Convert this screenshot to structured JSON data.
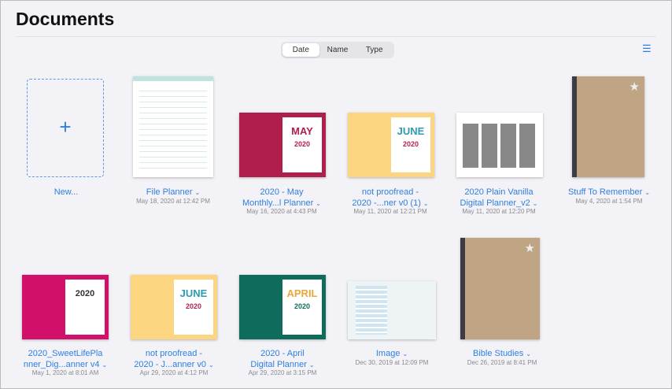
{
  "title": "Documents",
  "sort": {
    "options": [
      "Date",
      "Name",
      "Type"
    ],
    "selected": "Date"
  },
  "list_view_icon": "list-icon",
  "new_label": "New...",
  "row1": [
    {
      "l1": "File Planner",
      "l2": "",
      "date": "May 18, 2020 at 12:42 PM"
    },
    {
      "l1": "2020 - May",
      "l2": "Monthly...l Planner",
      "date": "May 16, 2020 at 4:43 PM"
    },
    {
      "l1": "not proofread -",
      "l2": "2020 -...ner v0 (1)",
      "date": "May 11, 2020 at 12:21 PM"
    },
    {
      "l1": "2020 Plain Vanilla",
      "l2": "Digital Planner_v2",
      "date": "May 11, 2020 at 12:20 PM"
    },
    {
      "l1": "Stuff To Remember",
      "l2": "",
      "date": "May 4, 2020 at 1:54 PM"
    }
  ],
  "row2": [
    {
      "l1": "2020_SweetLifePla",
      "l2": "nner_Dig...anner v4",
      "date": "May 1, 2020 at 8:01 AM"
    },
    {
      "l1": "not proofread -",
      "l2": "2020 - J...anner v0",
      "date": "Apr 29, 2020 at 4:12 PM"
    },
    {
      "l1": "2020 - April",
      "l2": "Digital Planner",
      "date": "Apr 29, 2020 at 3:15 PM"
    },
    {
      "l1": "Image",
      "l2": "",
      "date": "Dec 30, 2019 at 12:09 PM"
    },
    {
      "l1": "Bible Studies",
      "l2": "",
      "date": "Dec 26, 2019 at 8:41 PM"
    }
  ]
}
